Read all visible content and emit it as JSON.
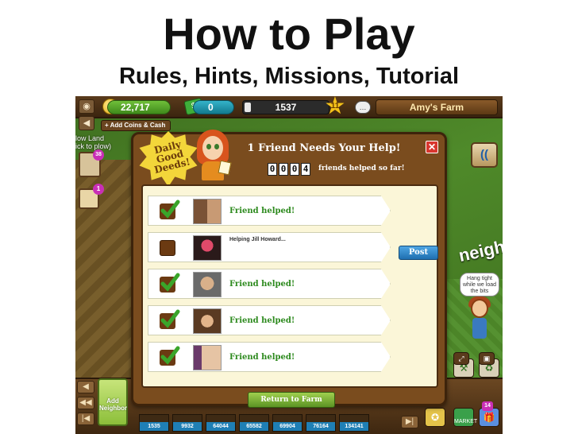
{
  "slide": {
    "title": "How to Play",
    "subtitle": "Rules, Hints, Missions, Tutorial"
  },
  "game": {
    "topbar": {
      "coins": "22,717",
      "cash": "0",
      "xp": "1537",
      "xp_fill_fraction": 0.08,
      "level": "11",
      "farm_name": "Amy's Farm",
      "add_coins_label": "+ Add Coins & Cash",
      "plow_label": "low Land\nick to plow)"
    },
    "side_badges": [
      "38",
      "1"
    ],
    "right_panel": {
      "neighbor_sign": "neigh",
      "bubble_text": "Hang tight while we load the bits"
    },
    "dialog": {
      "daily_badge": "Daily Good Deeds!",
      "title": "1 Friend Needs Your Help!",
      "counter_digits": [
        "0",
        "0",
        "0",
        "4"
      ],
      "counter_label": "friends helped so far!",
      "close_label": "✕",
      "rows": [
        {
          "checked": true,
          "status": "Friend helped!"
        },
        {
          "checked": false,
          "status": "Helping Jill Howard...",
          "action": "Post"
        },
        {
          "checked": true,
          "status": "Friend helped!"
        },
        {
          "checked": true,
          "status": "Friend helped!"
        },
        {
          "checked": true,
          "status": "Friend helped!"
        }
      ],
      "return_label": "Return to Farm"
    },
    "bottom": {
      "add_neighbor_label": "Add Neighbor",
      "neighbor_numbers": [
        "1535",
        "9932",
        "64044",
        "65582",
        "69904",
        "76164",
        "134141"
      ],
      "market_label": "MARKET",
      "gift_badge": "14"
    },
    "colors": {
      "accent_green": "#2d8a1e",
      "dialog_brown": "#7a4c1e",
      "post_blue": "#1f6fb0"
    }
  }
}
